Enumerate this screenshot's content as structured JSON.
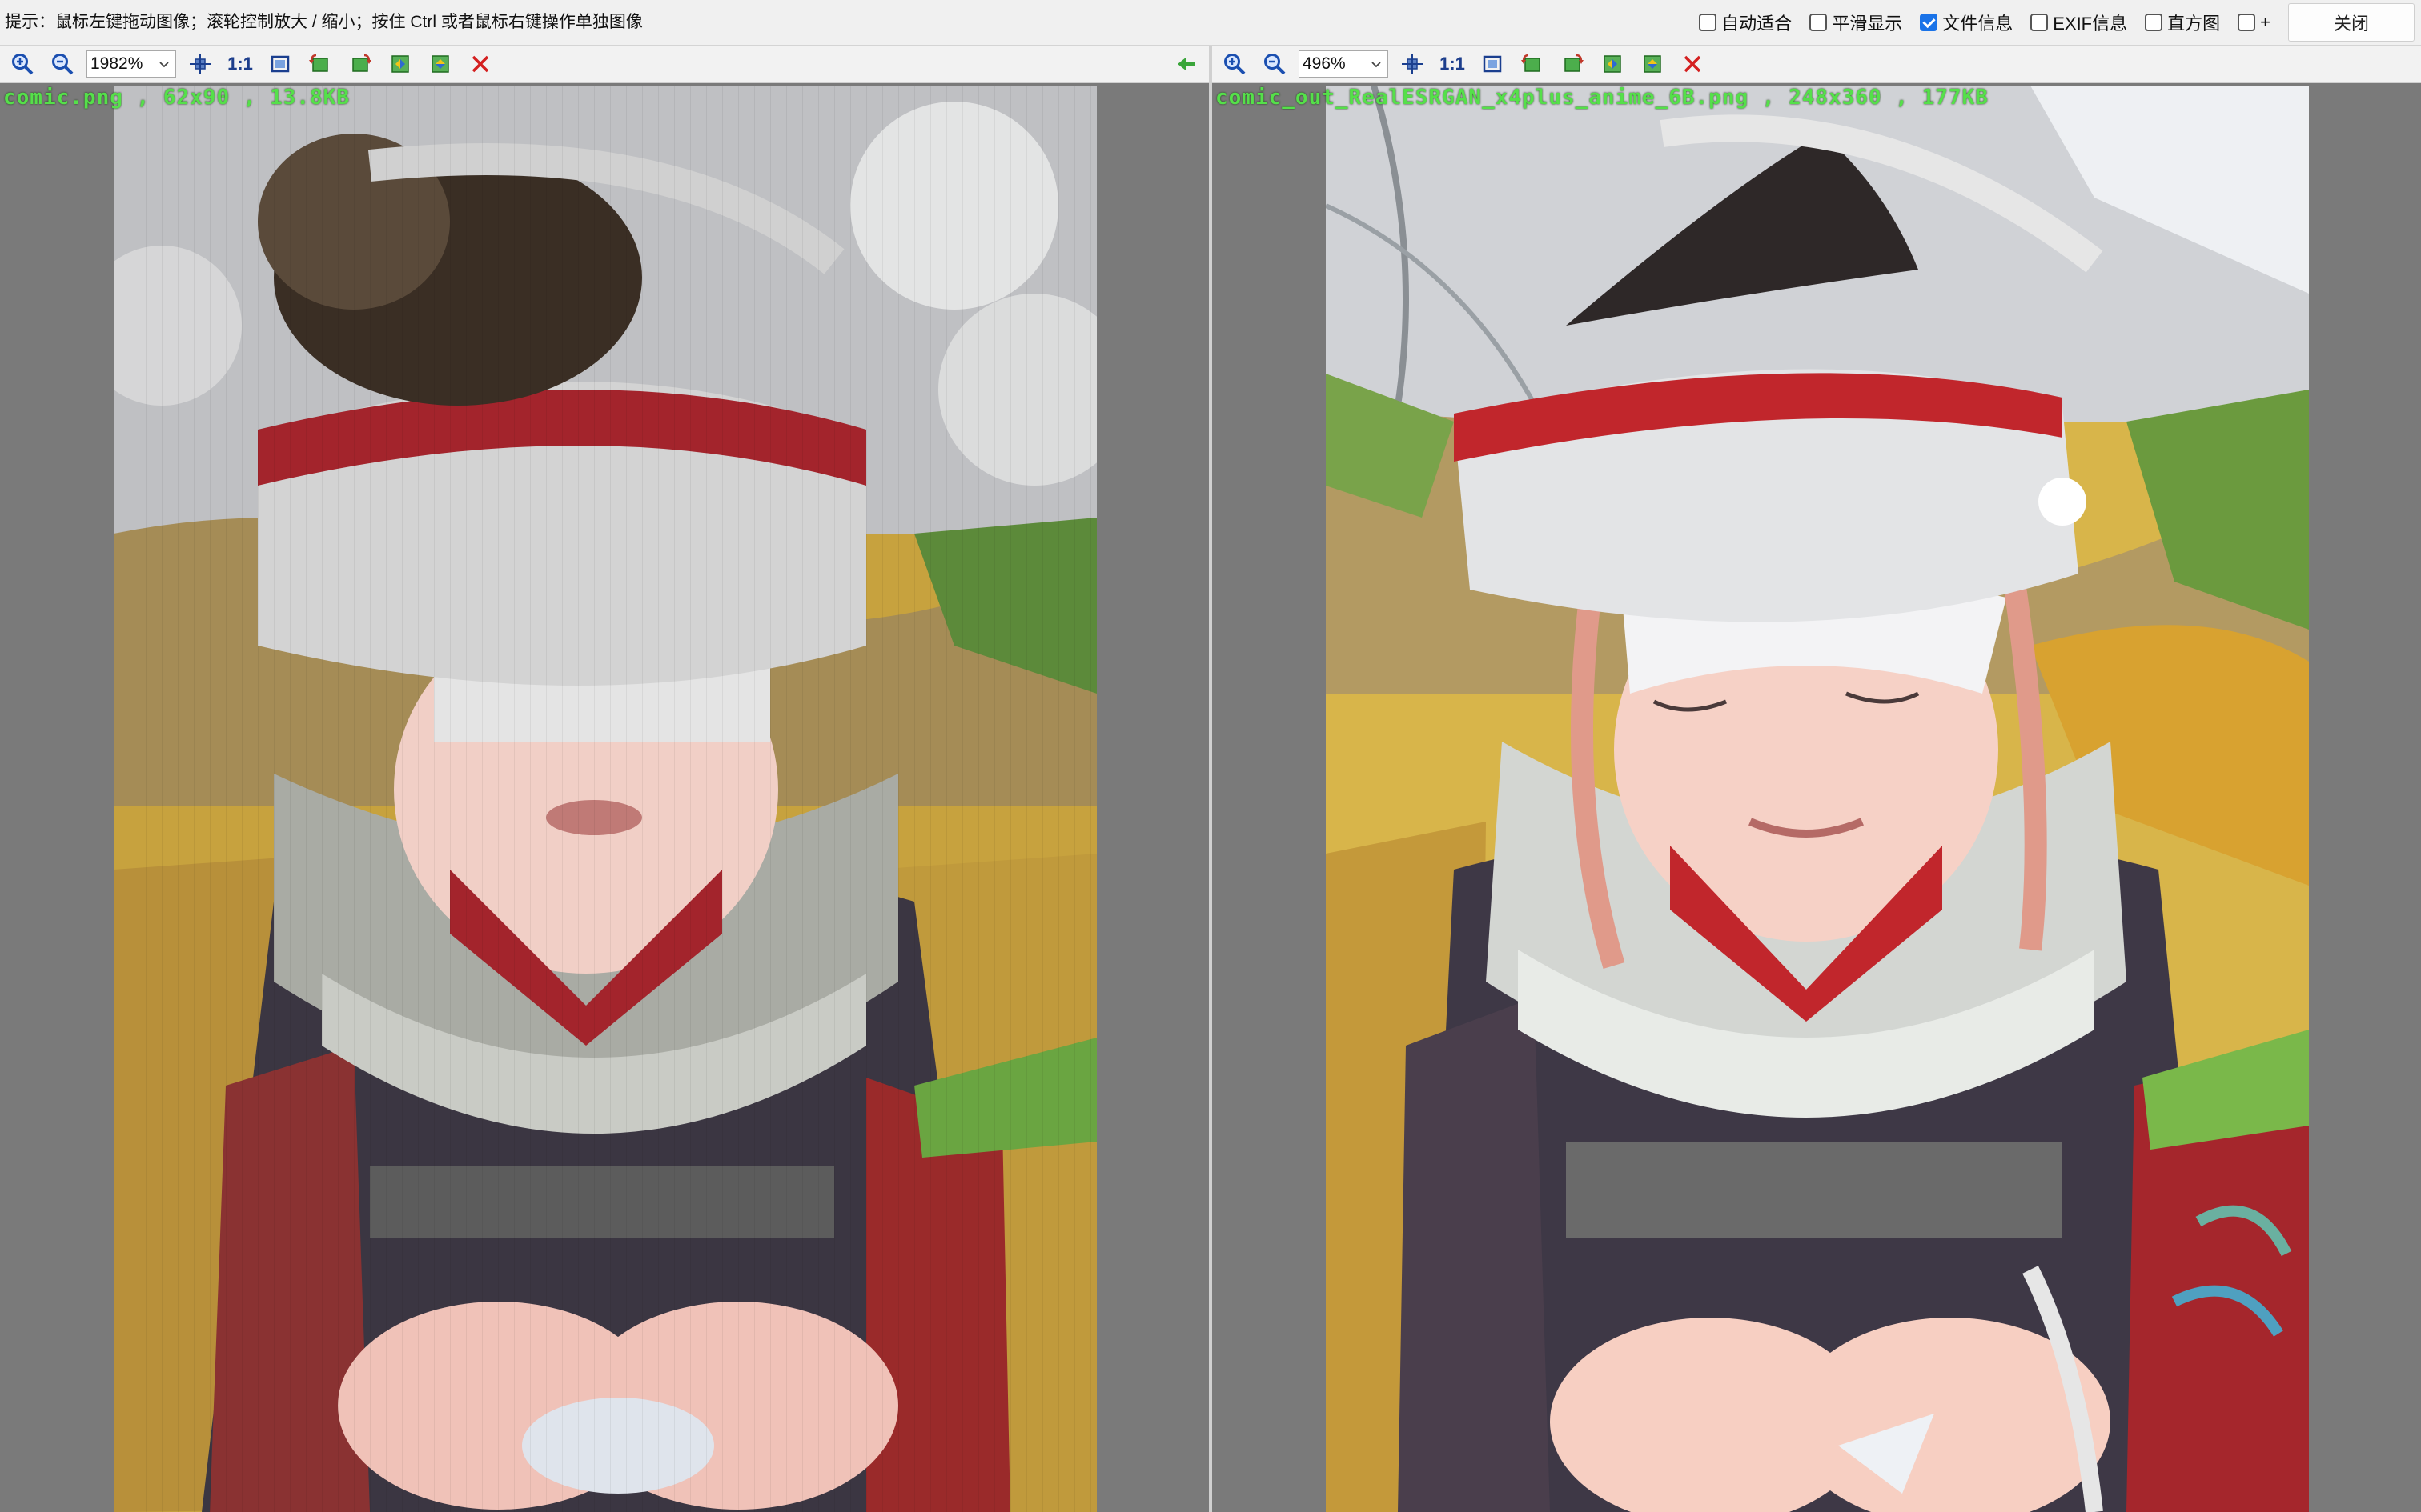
{
  "window": {
    "hint": "提示：鼠标左键拖动图像；滚轮控制放大 / 缩小；按住 Ctrl 或者鼠标右键操作单独图像",
    "options": [
      {
        "label": "自动适合",
        "checked": false
      },
      {
        "label": "平滑显示",
        "checked": false
      },
      {
        "label": "文件信息",
        "checked": true
      },
      {
        "label": "EXIF信息",
        "checked": false
      },
      {
        "label": "直方图",
        "checked": false
      },
      {
        "label": "+",
        "checked": false
      }
    ],
    "close_label": "关闭"
  },
  "panels": {
    "left": {
      "zoom": "1982%",
      "info": "comic.png , 62x90 , 13.8KB",
      "colors": {
        "sky": "#c9c9cc",
        "hat": "#d3d3d3",
        "red": "#a3242c",
        "skin": "#f1cfc6",
        "scarf": "#a9aba4",
        "coat": "#3b3642",
        "ground": "#c7a23e"
      }
    },
    "right": {
      "zoom": "496%",
      "info": "comic_out_RealESRGAN_x4plus_anime_6B.png , 248x360 , 177KB",
      "colors": {
        "sky": "#d0d2d6",
        "hat": "#e3e4e6",
        "red": "#c1262c",
        "skin": "#f6d1c6",
        "scarf": "#d3d6d2",
        "coat": "#3e3846",
        "ground": "#d8b54a"
      }
    }
  },
  "icons": {
    "zoom_in": "zoom-in-icon",
    "zoom_out": "zoom-out-icon",
    "center": "center-icon",
    "one_to_one": "1:1",
    "fit": "fit-screen-icon",
    "rotate_left": "rotate-left-icon",
    "rotate_right": "rotate-right-icon",
    "flip_h": "flip-horizontal-icon",
    "flip_v": "flip-vertical-icon",
    "close": "close-x-icon",
    "sync": "sync-arrow-icon"
  }
}
